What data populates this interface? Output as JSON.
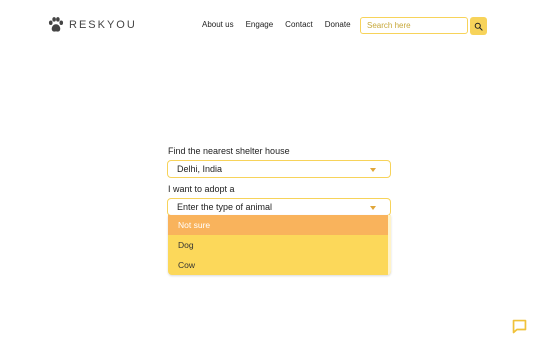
{
  "brand": {
    "name": "RESKYOU"
  },
  "nav": {
    "items": [
      "About us",
      "Engage",
      "Contact",
      "Donate"
    ]
  },
  "search": {
    "placeholder": "Search here"
  },
  "form": {
    "location_label": "Find the nearest shelter house",
    "location_value": "Delhi, India",
    "animal_label": "I want to adopt a",
    "animal_placeholder": "Enter the type of animal",
    "animal_options": [
      "Not sure",
      "Dog",
      "Cow"
    ],
    "highlighted_option": "Not sure"
  },
  "colors": {
    "accent": "#f7d35a",
    "dropdown_bg": "#fcd85a",
    "highlight": "#f9b35c"
  },
  "icons": {
    "logo": "paw-icon",
    "search": "search-icon",
    "caret": "chevron-down-icon",
    "chat": "chat-icon"
  }
}
